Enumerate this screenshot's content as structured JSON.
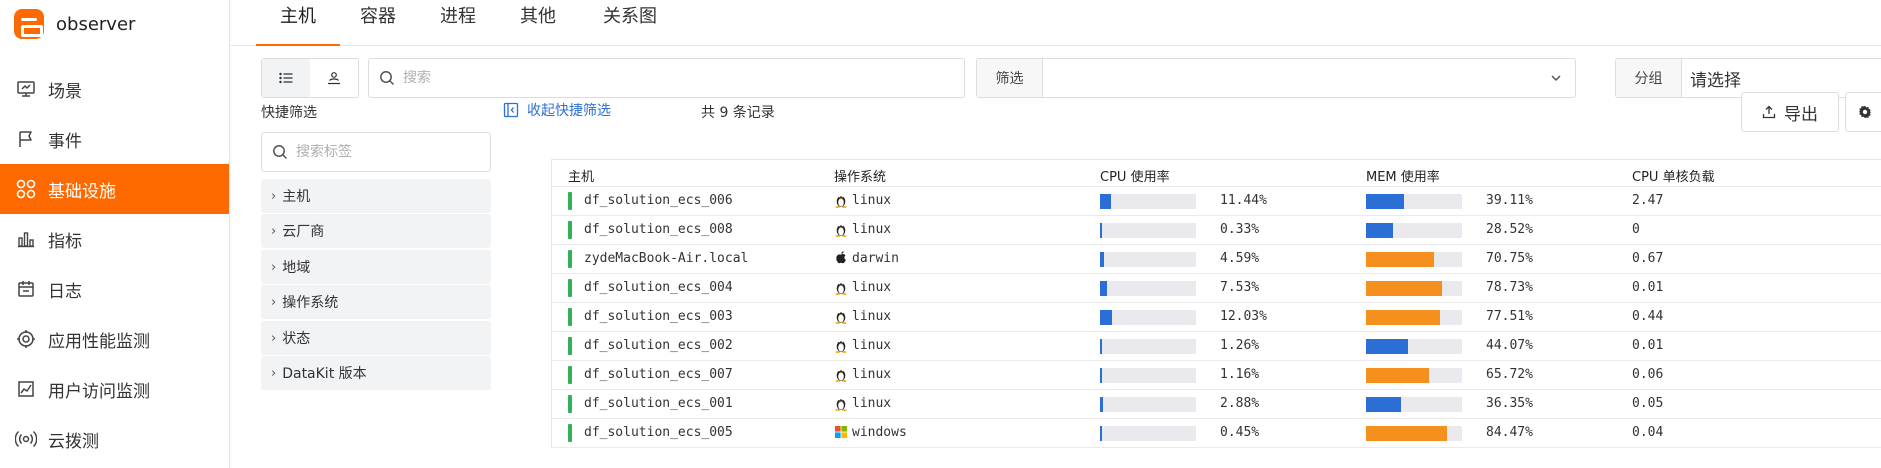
{
  "app": {
    "name": "observer"
  },
  "sidebar": {
    "items": [
      {
        "label": "场景",
        "icon": "monitor-icon",
        "active": false
      },
      {
        "label": "事件",
        "icon": "flag-icon",
        "active": false
      },
      {
        "label": "基础设施",
        "icon": "grid-circles-icon",
        "active": true
      },
      {
        "label": "指标",
        "icon": "bar-chart-icon",
        "active": false
      },
      {
        "label": "日志",
        "icon": "calendar-icon",
        "active": false
      },
      {
        "label": "应用性能监测",
        "icon": "target-icon",
        "active": false
      },
      {
        "label": "用户访问监测",
        "icon": "line-chart-icon",
        "active": false
      },
      {
        "label": "云拨测",
        "icon": "broadcast-icon",
        "active": false
      }
    ]
  },
  "tabs": [
    {
      "label": "主机",
      "active": true
    },
    {
      "label": "容器",
      "active": false
    },
    {
      "label": "进程",
      "active": false
    },
    {
      "label": "其他",
      "active": false
    },
    {
      "label": "关系图",
      "active": false
    }
  ],
  "toolbar": {
    "search_placeholder": "搜索",
    "filter_label": "筛选",
    "filter_value": "",
    "group_label": "分组",
    "group_value": "请选择",
    "export_label": "导出"
  },
  "quick_filter": {
    "title": "快捷筛选",
    "search_placeholder": "搜索标签",
    "collapse_label": "收起快捷筛选",
    "groups": [
      "主机",
      "云厂商",
      "地域",
      "操作系统",
      "状态",
      "DataKit 版本"
    ]
  },
  "records": {
    "summary": "共 9 条记录"
  },
  "table": {
    "columns": [
      "主机",
      "操作系统",
      "CPU 使用率",
      "MEM 使用率",
      "CPU 单核负载"
    ],
    "rows": [
      {
        "host": "df_solution_ecs_006",
        "os": "linux",
        "os_icon": "linux-icon",
        "cpu": "11.44%",
        "cpu_val": 11.44,
        "mem": "39.11%",
        "mem_val": 39.11,
        "load": "2.47"
      },
      {
        "host": "df_solution_ecs_008",
        "os": "linux",
        "os_icon": "linux-icon",
        "cpu": "0.33%",
        "cpu_val": 0.33,
        "mem": "28.52%",
        "mem_val": 28.52,
        "load": "0"
      },
      {
        "host": "zydeMacBook-Air.local",
        "os": "darwin",
        "os_icon": "apple-icon",
        "cpu": "4.59%",
        "cpu_val": 4.59,
        "mem": "70.75%",
        "mem_val": 70.75,
        "load": "0.67"
      },
      {
        "host": "df_solution_ecs_004",
        "os": "linux",
        "os_icon": "linux-icon",
        "cpu": "7.53%",
        "cpu_val": 7.53,
        "mem": "78.73%",
        "mem_val": 78.73,
        "load": "0.01"
      },
      {
        "host": "df_solution_ecs_003",
        "os": "linux",
        "os_icon": "linux-icon",
        "cpu": "12.03%",
        "cpu_val": 12.03,
        "mem": "77.51%",
        "mem_val": 77.51,
        "load": "0.44"
      },
      {
        "host": "df_solution_ecs_002",
        "os": "linux",
        "os_icon": "linux-icon",
        "cpu": "1.26%",
        "cpu_val": 1.26,
        "mem": "44.07%",
        "mem_val": 44.07,
        "load": "0.01"
      },
      {
        "host": "df_solution_ecs_007",
        "os": "linux",
        "os_icon": "linux-icon",
        "cpu": "1.16%",
        "cpu_val": 1.16,
        "mem": "65.72%",
        "mem_val": 65.72,
        "load": "0.06"
      },
      {
        "host": "df_solution_ecs_001",
        "os": "linux",
        "os_icon": "linux-icon",
        "cpu": "2.88%",
        "cpu_val": 2.88,
        "mem": "36.35%",
        "mem_val": 36.35,
        "load": "0.05"
      },
      {
        "host": "df_solution_ecs_005",
        "os": "windows",
        "os_icon": "windows-icon",
        "cpu": "0.45%",
        "cpu_val": 0.45,
        "mem": "84.47%",
        "mem_val": 84.47,
        "load": "0.04"
      }
    ]
  },
  "colors": {
    "accent": "#ff6a00",
    "status_ok": "#34b05a",
    "bar_blue": "#2b6fd6",
    "bar_orange": "#f5901e",
    "bar_track": "#e9e9ee",
    "link": "#2b6fd6"
  }
}
